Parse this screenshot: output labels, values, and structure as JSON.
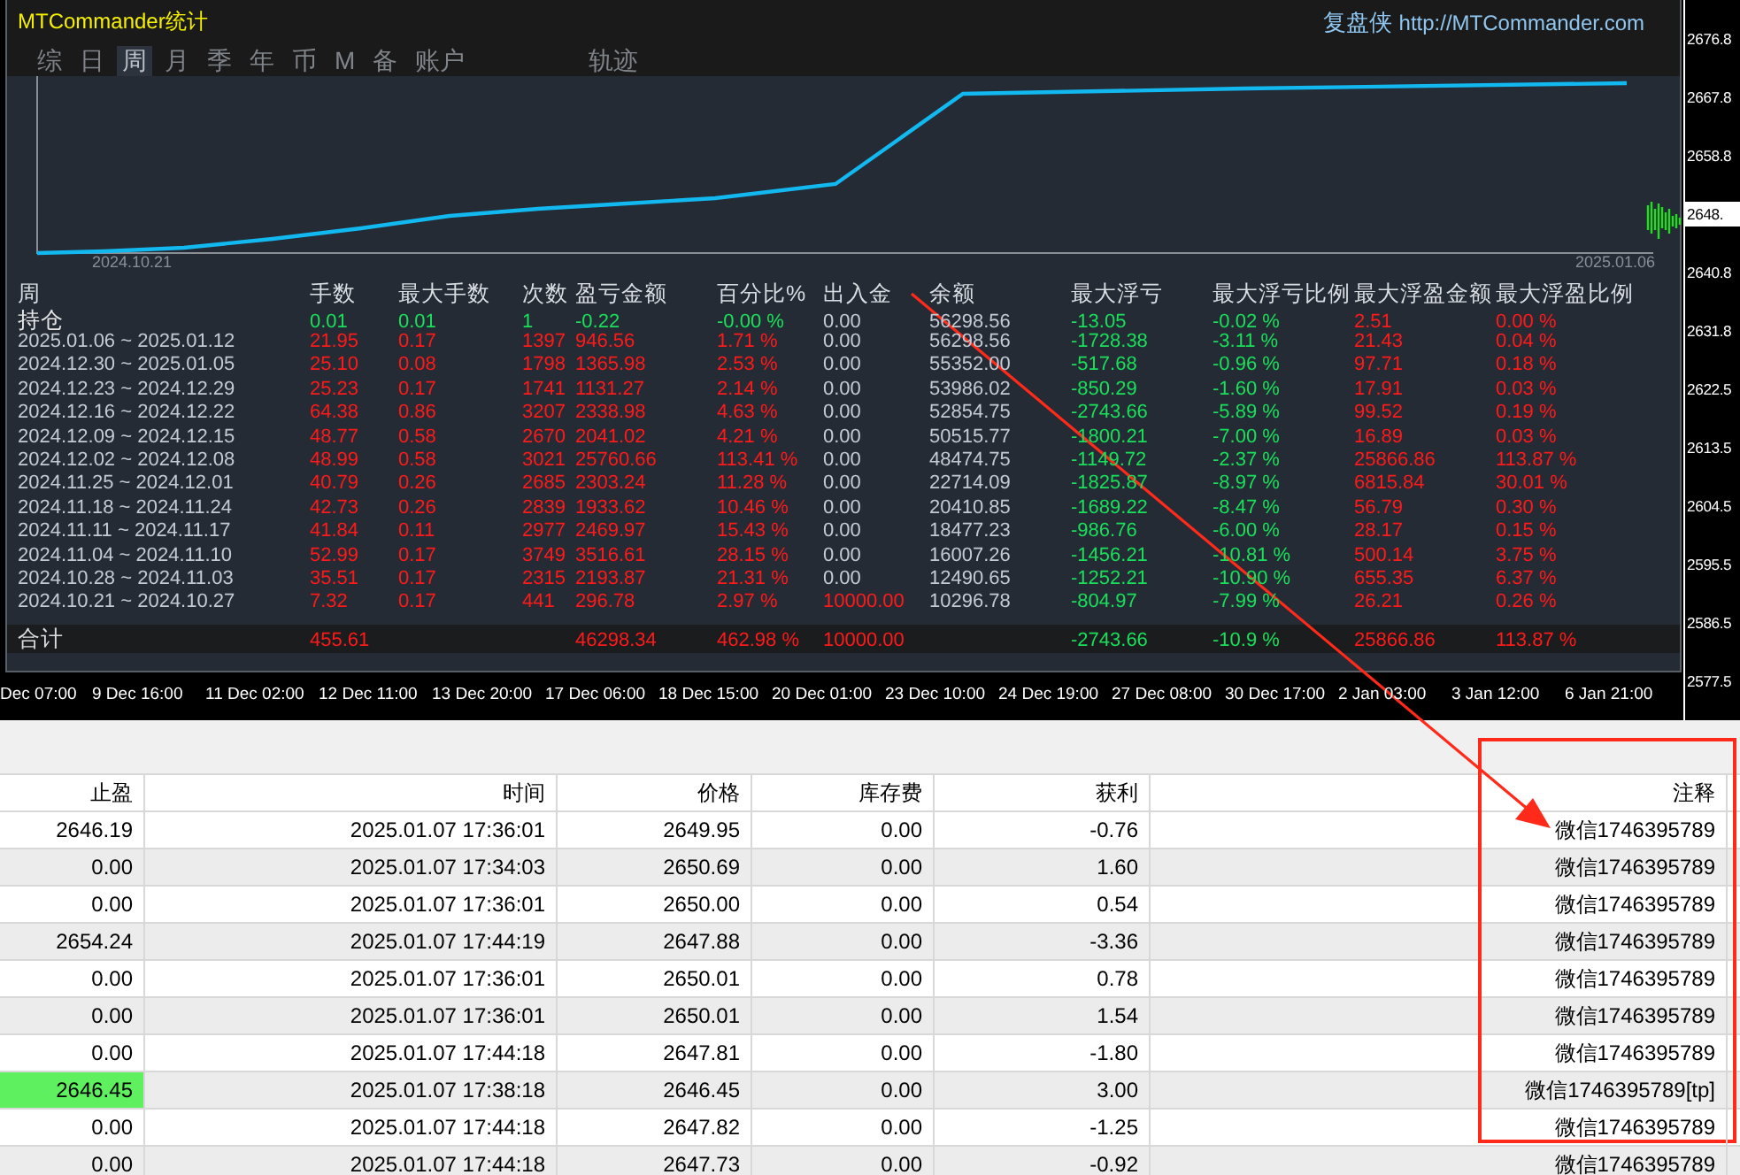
{
  "window": {
    "title": "MTCommander统计",
    "brand": "复盘侠",
    "url": "http://MTCommander.com"
  },
  "tabs": [
    {
      "label": "综",
      "selected": false
    },
    {
      "label": "日",
      "selected": false
    },
    {
      "label": "周",
      "selected": true
    },
    {
      "label": "月",
      "selected": false
    },
    {
      "label": "季",
      "selected": false
    },
    {
      "label": "年",
      "selected": false
    },
    {
      "label": "币",
      "selected": false
    },
    {
      "label": "M",
      "selected": false
    },
    {
      "label": "备",
      "selected": false
    },
    {
      "label": "账户",
      "selected": false
    }
  ],
  "track_button": "轨迹",
  "equity_chart": {
    "start_label": "2024.10.21",
    "end_label": "2025.01.06"
  },
  "stats": {
    "columns": [
      "周",
      "手数",
      "最大手数",
      "次数",
      "盈亏金额",
      "百分比%",
      "出入金",
      "余额",
      "最大浮亏",
      "最大浮亏比例",
      "最大浮盈金额",
      "最大浮盈比例"
    ],
    "rows": [
      {
        "kind": "open",
        "deposit_in": false,
        "cells": [
          "持仓",
          "0.01",
          "0.01",
          "1",
          "-0.22",
          "-0.00 %",
          "0.00",
          "56298.56",
          "-13.05",
          "-0.02 %",
          "2.51",
          "0.00 %"
        ]
      },
      {
        "kind": "week",
        "deposit_in": false,
        "cells": [
          "2025.01.06 ~ 2025.01.12",
          "21.95",
          "0.17",
          "1397",
          "946.56",
          "1.71 %",
          "0.00",
          "56298.56",
          "-1728.38",
          "-3.11 %",
          "21.43",
          "0.04 %"
        ]
      },
      {
        "kind": "week",
        "deposit_in": false,
        "cells": [
          "2024.12.30 ~ 2025.01.05",
          "25.10",
          "0.08",
          "1798",
          "1365.98",
          "2.53 %",
          "0.00",
          "55352.00",
          "-517.68",
          "-0.96 %",
          "97.71",
          "0.18 %"
        ]
      },
      {
        "kind": "week",
        "deposit_in": false,
        "cells": [
          "2024.12.23 ~ 2024.12.29",
          "25.23",
          "0.17",
          "1741",
          "1131.27",
          "2.14 %",
          "0.00",
          "53986.02",
          "-850.29",
          "-1.60 %",
          "17.91",
          "0.03 %"
        ]
      },
      {
        "kind": "week",
        "deposit_in": false,
        "cells": [
          "2024.12.16 ~ 2024.12.22",
          "64.38",
          "0.86",
          "3207",
          "2338.98",
          "4.63 %",
          "0.00",
          "52854.75",
          "-2743.66",
          "-5.89 %",
          "99.52",
          "0.19 %"
        ]
      },
      {
        "kind": "week",
        "deposit_in": false,
        "cells": [
          "2024.12.09 ~ 2024.12.15",
          "48.77",
          "0.58",
          "2670",
          "2041.02",
          "4.21 %",
          "0.00",
          "50515.77",
          "-1800.21",
          "-7.00 %",
          "16.89",
          "0.03 %"
        ]
      },
      {
        "kind": "week",
        "deposit_in": false,
        "cells": [
          "2024.12.02 ~ 2024.12.08",
          "48.99",
          "0.58",
          "3021",
          "25760.66",
          "113.41 %",
          "0.00",
          "48474.75",
          "-1149.72",
          "-2.37 %",
          "25866.86",
          "113.87 %"
        ]
      },
      {
        "kind": "week",
        "deposit_in": false,
        "cells": [
          "2024.11.25 ~ 2024.12.01",
          "40.79",
          "0.26",
          "2685",
          "2303.24",
          "11.28 %",
          "0.00",
          "22714.09",
          "-1825.87",
          "-8.97 %",
          "6815.84",
          "30.01 %"
        ]
      },
      {
        "kind": "week",
        "deposit_in": false,
        "cells": [
          "2024.11.18 ~ 2024.11.24",
          "42.73",
          "0.26",
          "2839",
          "1933.62",
          "10.46 %",
          "0.00",
          "20410.85",
          "-1689.22",
          "-8.47 %",
          "56.79",
          "0.30 %"
        ]
      },
      {
        "kind": "week",
        "deposit_in": false,
        "cells": [
          "2024.11.11 ~ 2024.11.17",
          "41.84",
          "0.11",
          "2977",
          "2469.97",
          "15.43 %",
          "0.00",
          "18477.23",
          "-986.76",
          "-6.00 %",
          "28.17",
          "0.15 %"
        ]
      },
      {
        "kind": "week",
        "deposit_in": false,
        "cells": [
          "2024.11.04 ~ 2024.11.10",
          "52.99",
          "0.17",
          "3749",
          "3516.61",
          "28.15 %",
          "0.00",
          "16007.26",
          "-1456.21",
          "-10.81 %",
          "500.14",
          "3.75 %"
        ]
      },
      {
        "kind": "week",
        "deposit_in": false,
        "cells": [
          "2024.10.28 ~ 2024.11.03",
          "35.51",
          "0.17",
          "2315",
          "2193.87",
          "21.31 %",
          "0.00",
          "12490.65",
          "-1252.21",
          "-10.90 %",
          "655.35",
          "6.37 %"
        ]
      },
      {
        "kind": "week",
        "deposit_in": true,
        "cells": [
          "2024.10.21 ~ 2024.10.27",
          "7.32",
          "0.17",
          "441",
          "296.78",
          "2.97 %",
          "10000.00",
          "10296.78",
          "-804.97",
          "-7.99 %",
          "26.21",
          "0.26 %"
        ]
      }
    ],
    "total": {
      "label": "合计",
      "lots": "455.61",
      "profit": "46298.34",
      "percent": "462.98 %",
      "deposit": "10000.00",
      "max_float_loss": "-2743.66",
      "max_float_loss_pct": "-10.9 %",
      "max_float_profit": "25866.86",
      "max_float_profit_pct": "113.87 %"
    }
  },
  "price_axis": [
    {
      "label": "2676.8",
      "kind": "grid"
    },
    {
      "label": "2667.8",
      "kind": "grid"
    },
    {
      "label": "2658.8",
      "kind": "grid"
    },
    {
      "label": "2648.",
      "kind": "current"
    },
    {
      "label": "2640.8",
      "kind": "grid"
    },
    {
      "label": "2631.8",
      "kind": "grid"
    },
    {
      "label": "2622.5",
      "kind": "grid"
    },
    {
      "label": "2613.5",
      "kind": "grid"
    },
    {
      "label": "2604.5",
      "kind": "grid"
    },
    {
      "label": "2595.5",
      "kind": "grid"
    },
    {
      "label": "2586.5",
      "kind": "grid"
    },
    {
      "label": "2577.5",
      "kind": "grid"
    }
  ],
  "time_axis": [
    "Dec 07:00",
    "9 Dec 16:00",
    "11 Dec 02:00",
    "12 Dec 11:00",
    "13 Dec 20:00",
    "17 Dec 06:00",
    "18 Dec 15:00",
    "20 Dec 01:00",
    "23 Dec 10:00",
    "24 Dec 19:00",
    "27 Dec 08:00",
    "30 Dec 17:00",
    "2 Jan 03:00",
    "3 Jan 12:00",
    "6 Jan 21:00"
  ],
  "orders": {
    "columns": [
      "止盈",
      "时间",
      "价格",
      "库存费",
      "获利",
      "注释"
    ],
    "rows": [
      {
        "tp_hit": false,
        "cells": [
          "2646.19",
          "2025.01.07 17:36:01",
          "2649.95",
          "0.00",
          "-0.76",
          "微信1746395789"
        ]
      },
      {
        "tp_hit": false,
        "cells": [
          "0.00",
          "2025.01.07 17:34:03",
          "2650.69",
          "0.00",
          "1.60",
          "微信1746395789"
        ]
      },
      {
        "tp_hit": false,
        "cells": [
          "0.00",
          "2025.01.07 17:36:01",
          "2650.00",
          "0.00",
          "0.54",
          "微信1746395789"
        ]
      },
      {
        "tp_hit": false,
        "cells": [
          "2654.24",
          "2025.01.07 17:44:19",
          "2647.88",
          "0.00",
          "-3.36",
          "微信1746395789"
        ]
      },
      {
        "tp_hit": false,
        "cells": [
          "0.00",
          "2025.01.07 17:36:01",
          "2650.01",
          "0.00",
          "0.78",
          "微信1746395789"
        ]
      },
      {
        "tp_hit": false,
        "cells": [
          "0.00",
          "2025.01.07 17:36:01",
          "2650.01",
          "0.00",
          "1.54",
          "微信1746395789"
        ]
      },
      {
        "tp_hit": false,
        "cells": [
          "0.00",
          "2025.01.07 17:44:18",
          "2647.81",
          "0.00",
          "-1.80",
          "微信1746395789"
        ]
      },
      {
        "tp_hit": true,
        "cells": [
          "2646.45",
          "2025.01.07 17:38:18",
          "2646.45",
          "0.00",
          "3.00",
          "微信1746395789[tp]"
        ]
      },
      {
        "tp_hit": false,
        "cells": [
          "0.00",
          "2025.01.07 17:44:18",
          "2647.82",
          "0.00",
          "-1.25",
          "微信1746395789"
        ]
      },
      {
        "tp_hit": false,
        "cells": [
          "0.00",
          "2025.01.07 17:44:18",
          "2647.73",
          "0.00",
          "-0.92",
          "微信1746395789"
        ]
      }
    ]
  }
}
